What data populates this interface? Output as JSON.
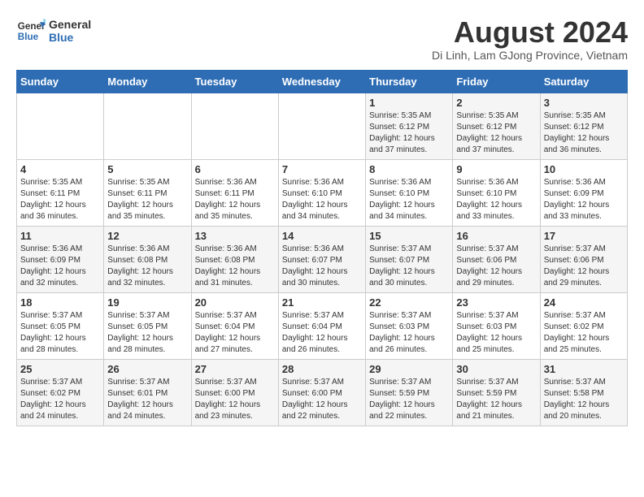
{
  "header": {
    "logo_line1": "General",
    "logo_line2": "Blue",
    "month_year": "August 2024",
    "location": "Di Linh, Lam GJong Province, Vietnam"
  },
  "days_of_week": [
    "Sunday",
    "Monday",
    "Tuesday",
    "Wednesday",
    "Thursday",
    "Friday",
    "Saturday"
  ],
  "weeks": [
    [
      {
        "day": "",
        "info": ""
      },
      {
        "day": "",
        "info": ""
      },
      {
        "day": "",
        "info": ""
      },
      {
        "day": "",
        "info": ""
      },
      {
        "day": "1",
        "info": "Sunrise: 5:35 AM\nSunset: 6:12 PM\nDaylight: 12 hours\nand 37 minutes."
      },
      {
        "day": "2",
        "info": "Sunrise: 5:35 AM\nSunset: 6:12 PM\nDaylight: 12 hours\nand 37 minutes."
      },
      {
        "day": "3",
        "info": "Sunrise: 5:35 AM\nSunset: 6:12 PM\nDaylight: 12 hours\nand 36 minutes."
      }
    ],
    [
      {
        "day": "4",
        "info": "Sunrise: 5:35 AM\nSunset: 6:11 PM\nDaylight: 12 hours\nand 36 minutes."
      },
      {
        "day": "5",
        "info": "Sunrise: 5:35 AM\nSunset: 6:11 PM\nDaylight: 12 hours\nand 35 minutes."
      },
      {
        "day": "6",
        "info": "Sunrise: 5:36 AM\nSunset: 6:11 PM\nDaylight: 12 hours\nand 35 minutes."
      },
      {
        "day": "7",
        "info": "Sunrise: 5:36 AM\nSunset: 6:10 PM\nDaylight: 12 hours\nand 34 minutes."
      },
      {
        "day": "8",
        "info": "Sunrise: 5:36 AM\nSunset: 6:10 PM\nDaylight: 12 hours\nand 34 minutes."
      },
      {
        "day": "9",
        "info": "Sunrise: 5:36 AM\nSunset: 6:10 PM\nDaylight: 12 hours\nand 33 minutes."
      },
      {
        "day": "10",
        "info": "Sunrise: 5:36 AM\nSunset: 6:09 PM\nDaylight: 12 hours\nand 33 minutes."
      }
    ],
    [
      {
        "day": "11",
        "info": "Sunrise: 5:36 AM\nSunset: 6:09 PM\nDaylight: 12 hours\nand 32 minutes."
      },
      {
        "day": "12",
        "info": "Sunrise: 5:36 AM\nSunset: 6:08 PM\nDaylight: 12 hours\nand 32 minutes."
      },
      {
        "day": "13",
        "info": "Sunrise: 5:36 AM\nSunset: 6:08 PM\nDaylight: 12 hours\nand 31 minutes."
      },
      {
        "day": "14",
        "info": "Sunrise: 5:36 AM\nSunset: 6:07 PM\nDaylight: 12 hours\nand 30 minutes."
      },
      {
        "day": "15",
        "info": "Sunrise: 5:37 AM\nSunset: 6:07 PM\nDaylight: 12 hours\nand 30 minutes."
      },
      {
        "day": "16",
        "info": "Sunrise: 5:37 AM\nSunset: 6:06 PM\nDaylight: 12 hours\nand 29 minutes."
      },
      {
        "day": "17",
        "info": "Sunrise: 5:37 AM\nSunset: 6:06 PM\nDaylight: 12 hours\nand 29 minutes."
      }
    ],
    [
      {
        "day": "18",
        "info": "Sunrise: 5:37 AM\nSunset: 6:05 PM\nDaylight: 12 hours\nand 28 minutes."
      },
      {
        "day": "19",
        "info": "Sunrise: 5:37 AM\nSunset: 6:05 PM\nDaylight: 12 hours\nand 28 minutes."
      },
      {
        "day": "20",
        "info": "Sunrise: 5:37 AM\nSunset: 6:04 PM\nDaylight: 12 hours\nand 27 minutes."
      },
      {
        "day": "21",
        "info": "Sunrise: 5:37 AM\nSunset: 6:04 PM\nDaylight: 12 hours\nand 26 minutes."
      },
      {
        "day": "22",
        "info": "Sunrise: 5:37 AM\nSunset: 6:03 PM\nDaylight: 12 hours\nand 26 minutes."
      },
      {
        "day": "23",
        "info": "Sunrise: 5:37 AM\nSunset: 6:03 PM\nDaylight: 12 hours\nand 25 minutes."
      },
      {
        "day": "24",
        "info": "Sunrise: 5:37 AM\nSunset: 6:02 PM\nDaylight: 12 hours\nand 25 minutes."
      }
    ],
    [
      {
        "day": "25",
        "info": "Sunrise: 5:37 AM\nSunset: 6:02 PM\nDaylight: 12 hours\nand 24 minutes."
      },
      {
        "day": "26",
        "info": "Sunrise: 5:37 AM\nSunset: 6:01 PM\nDaylight: 12 hours\nand 24 minutes."
      },
      {
        "day": "27",
        "info": "Sunrise: 5:37 AM\nSunset: 6:00 PM\nDaylight: 12 hours\nand 23 minutes."
      },
      {
        "day": "28",
        "info": "Sunrise: 5:37 AM\nSunset: 6:00 PM\nDaylight: 12 hours\nand 22 minutes."
      },
      {
        "day": "29",
        "info": "Sunrise: 5:37 AM\nSunset: 5:59 PM\nDaylight: 12 hours\nand 22 minutes."
      },
      {
        "day": "30",
        "info": "Sunrise: 5:37 AM\nSunset: 5:59 PM\nDaylight: 12 hours\nand 21 minutes."
      },
      {
        "day": "31",
        "info": "Sunrise: 5:37 AM\nSunset: 5:58 PM\nDaylight: 12 hours\nand 20 minutes."
      }
    ]
  ]
}
